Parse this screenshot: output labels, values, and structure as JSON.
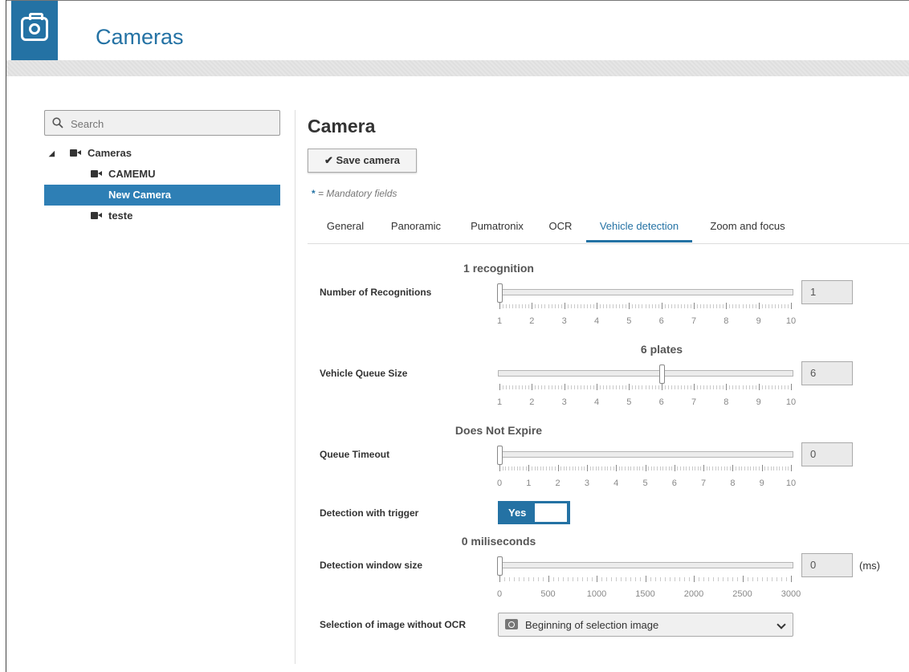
{
  "header": {
    "title": "Cameras"
  },
  "search": {
    "placeholder": "Search"
  },
  "tree": {
    "root": "Cameras",
    "items": [
      "CAMEMU",
      "New Camera",
      "teste"
    ]
  },
  "page": {
    "title": "Camera",
    "save_label": "Save camera",
    "mandatory_star": "*",
    "mandatory_text": "= Mandatory fields"
  },
  "tabs": [
    "General",
    "Panoramic",
    "Pumatronix",
    "OCR",
    "Vehicle detection",
    "Zoom and focus"
  ],
  "active_tab": "Vehicle detection",
  "fields": {
    "recognitions": {
      "label": "Number of Recognitions",
      "caption": "1 recognition",
      "value": "1",
      "min": 1,
      "max": 10,
      "current": 1,
      "ticks": [
        "1",
        "2",
        "3",
        "4",
        "5",
        "6",
        "7",
        "8",
        "9",
        "10"
      ]
    },
    "queue_size": {
      "label": "Vehicle Queue Size",
      "caption": "6 plates",
      "value": "6",
      "min": 1,
      "max": 10,
      "current": 6,
      "ticks": [
        "1",
        "2",
        "3",
        "4",
        "5",
        "6",
        "7",
        "8",
        "9",
        "10"
      ]
    },
    "queue_timeout": {
      "label": "Queue Timeout",
      "caption": "Does Not Expire",
      "value": "0",
      "min": 0,
      "max": 10,
      "current": 0,
      "ticks": [
        "0",
        "1",
        "2",
        "3",
        "4",
        "5",
        "6",
        "7",
        "8",
        "9",
        "10"
      ]
    },
    "trigger": {
      "label": "Detection with trigger",
      "toggle_label": "Yes"
    },
    "window_size": {
      "label": "Detection window size",
      "caption": "0 miliseconds",
      "value": "0",
      "unit": "(ms)",
      "min": 0,
      "max": 3000,
      "current": 0,
      "ticks": [
        "0",
        "500",
        "1000",
        "1500",
        "2000",
        "2500",
        "3000"
      ]
    },
    "image_selection": {
      "label": "Selection of image without OCR",
      "selected": "Beginning of selection image"
    }
  },
  "colors": {
    "accent": "#2472a4",
    "selected_row": "#2e7fb5"
  }
}
